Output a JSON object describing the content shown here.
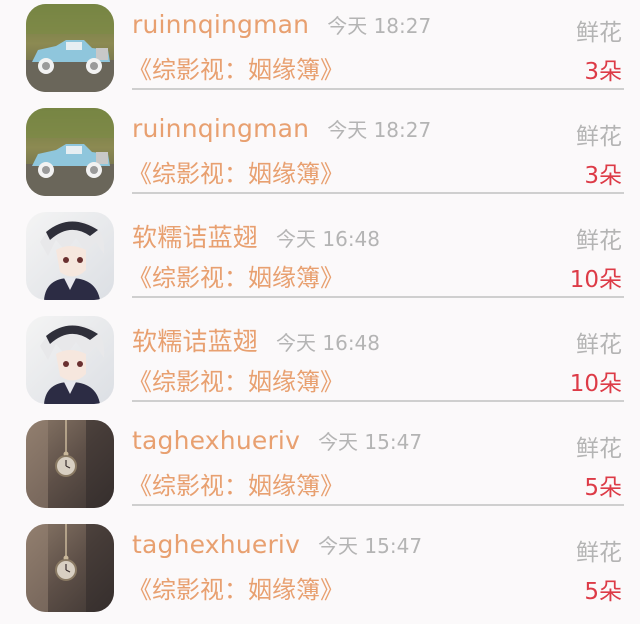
{
  "rows": [
    {
      "username": "ruinnqingman",
      "time": "今天 18:27",
      "gift": "鲜花",
      "book": "《综影视：姻缘簿》",
      "count": "3朵",
      "avatar": "vintage-car-avatar"
    },
    {
      "username": "ruinnqingman",
      "time": "今天 18:27",
      "gift": "鲜花",
      "book": "《综影视：姻缘簿》",
      "count": "3朵",
      "avatar": "vintage-car-avatar"
    },
    {
      "username": "软糯诘蓝翅",
      "time": "今天 16:48",
      "gift": "鲜花",
      "book": "《综影视：姻缘簿》",
      "count": "10朵",
      "avatar": "anime-boy-avatar"
    },
    {
      "username": "软糯诘蓝翅",
      "time": "今天 16:48",
      "gift": "鲜花",
      "book": "《综影视：姻缘簿》",
      "count": "10朵",
      "avatar": "anime-boy-avatar"
    },
    {
      "username": "taghexhueriv",
      "time": "今天 15:47",
      "gift": "鲜花",
      "book": "《综影视：姻缘簿》",
      "count": "5朵",
      "avatar": "pocket-watch-avatar"
    },
    {
      "username": "taghexhueriv",
      "time": "今天 15:47",
      "gift": "鲜花",
      "book": "《综影视：姻缘簿》",
      "count": "5朵",
      "avatar": "pocket-watch-avatar"
    }
  ],
  "colors": {
    "username": "#e8a070",
    "time": "#b4b4b4",
    "count": "#dd3b47",
    "divider": "#cfcfcf"
  }
}
